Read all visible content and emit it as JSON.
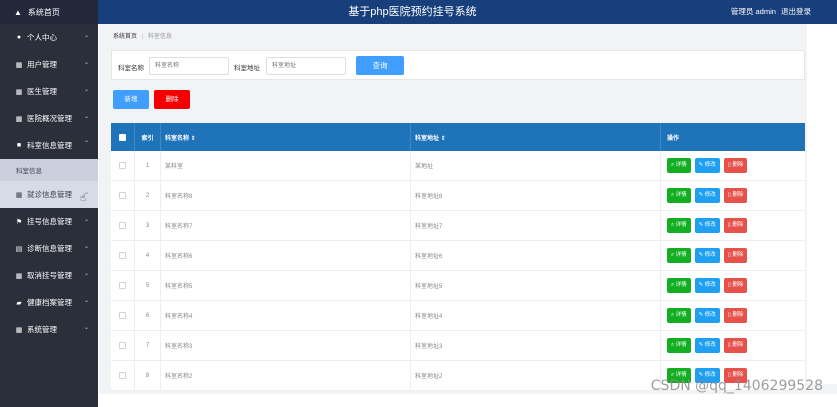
{
  "header": {
    "home_label": "系统首页",
    "title": "基于php医院预约挂号系统",
    "user_label": "管理员 admin",
    "logout_label": "退出登录"
  },
  "sidebar": {
    "items": [
      {
        "label": "个人中心",
        "icon": "user-icon"
      },
      {
        "label": "用户管理",
        "icon": "grid-icon"
      },
      {
        "label": "医生管理",
        "icon": "grid-icon"
      },
      {
        "label": "医院概况管理",
        "icon": "grid-icon"
      },
      {
        "label": "科室信息管理",
        "icon": "trash-icon"
      },
      {
        "label": "就诊信息管理",
        "icon": "grid-icon"
      },
      {
        "label": "挂号信息管理",
        "icon": "flag-icon"
      },
      {
        "label": "诊断信息管理",
        "icon": "table-icon"
      },
      {
        "label": "取消挂号管理",
        "icon": "grid-icon"
      },
      {
        "label": "健康档案管理",
        "icon": "briefcase-icon"
      },
      {
        "label": "系统管理",
        "icon": "grid-icon"
      }
    ],
    "submenu_label": "科室信息"
  },
  "breadcrumb": {
    "home": "系统首页",
    "current": "科室信息"
  },
  "search": {
    "name_label": "科室名称",
    "name_placeholder": "科室名称",
    "address_label": "科室地址",
    "address_placeholder": "科室地址",
    "query_button": "查询"
  },
  "actions": {
    "add_label": "新增",
    "delete_label": "删除"
  },
  "table": {
    "headers": {
      "index": "索引",
      "name": "科室名称 ⇕",
      "address": "科室地址 ⇕",
      "operation": "操作"
    },
    "op_labels": {
      "detail": "详情",
      "edit": "修改",
      "delete": "删除"
    },
    "rows": [
      {
        "index": "1",
        "name": "某科室",
        "address": "某地址"
      },
      {
        "index": "2",
        "name": "科室名称8",
        "address": "科室地址8"
      },
      {
        "index": "3",
        "name": "科室名称7",
        "address": "科室地址7"
      },
      {
        "index": "4",
        "name": "科室名称6",
        "address": "科室地址6"
      },
      {
        "index": "5",
        "name": "科室名称5",
        "address": "科室地址5"
      },
      {
        "index": "6",
        "name": "科室名称4",
        "address": "科室地址4"
      },
      {
        "index": "7",
        "name": "科室名称3",
        "address": "科室地址3"
      },
      {
        "index": "8",
        "name": "科室名称2",
        "address": "科室地址2"
      }
    ]
  },
  "watermark": "CSDN @qq_1406299528",
  "colors": {
    "topbar": "#173f7c",
    "sidebar": "#2b2f3a",
    "table_header": "#1f73b8",
    "primary": "#409eff",
    "danger": "#f40000",
    "detail": "#13ae22",
    "edit": "#1e9ff2",
    "op_delete": "#e6514a"
  }
}
